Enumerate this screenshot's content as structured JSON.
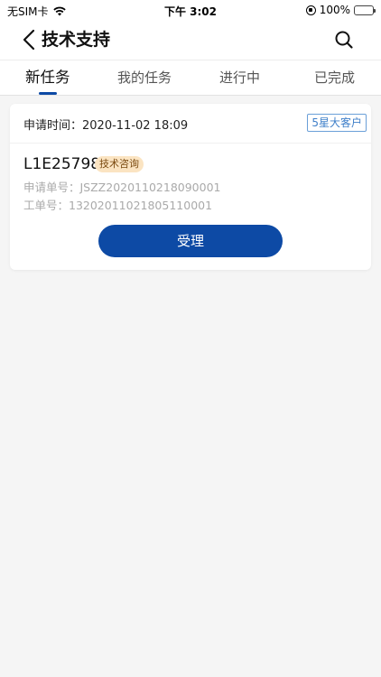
{
  "status_bar": {
    "carrier": "无SIM卡",
    "time": "下午 3:02",
    "battery_percent": "100%",
    "icons": [
      "wifi-icon",
      "rotation-lock-icon",
      "battery-charging-icon"
    ]
  },
  "nav": {
    "title": "技术支持",
    "back_icon": "chevron-left-icon",
    "search_icon": "search-icon"
  },
  "tabs": [
    {
      "label": "新任务",
      "active": true
    },
    {
      "label": "我的任务",
      "active": false
    },
    {
      "label": "进行中",
      "active": false
    },
    {
      "label": "已完成",
      "active": false
    }
  ],
  "task": {
    "apply_time": "申请时间：2020-11-02 18:09",
    "customer_level": "5星大客户",
    "code": "L1E25798",
    "type_tag": "技术咨询",
    "application_no": "申请单号：JSZZ2020110218090001",
    "work_order_no": "工单号：13202011021805110001",
    "accept_label": "受理"
  },
  "colors": {
    "accent": "#0d4aa5",
    "tag_bg": "#fbe4c2",
    "badge_border": "#6a9fd8",
    "background": "#f5f5f5"
  }
}
